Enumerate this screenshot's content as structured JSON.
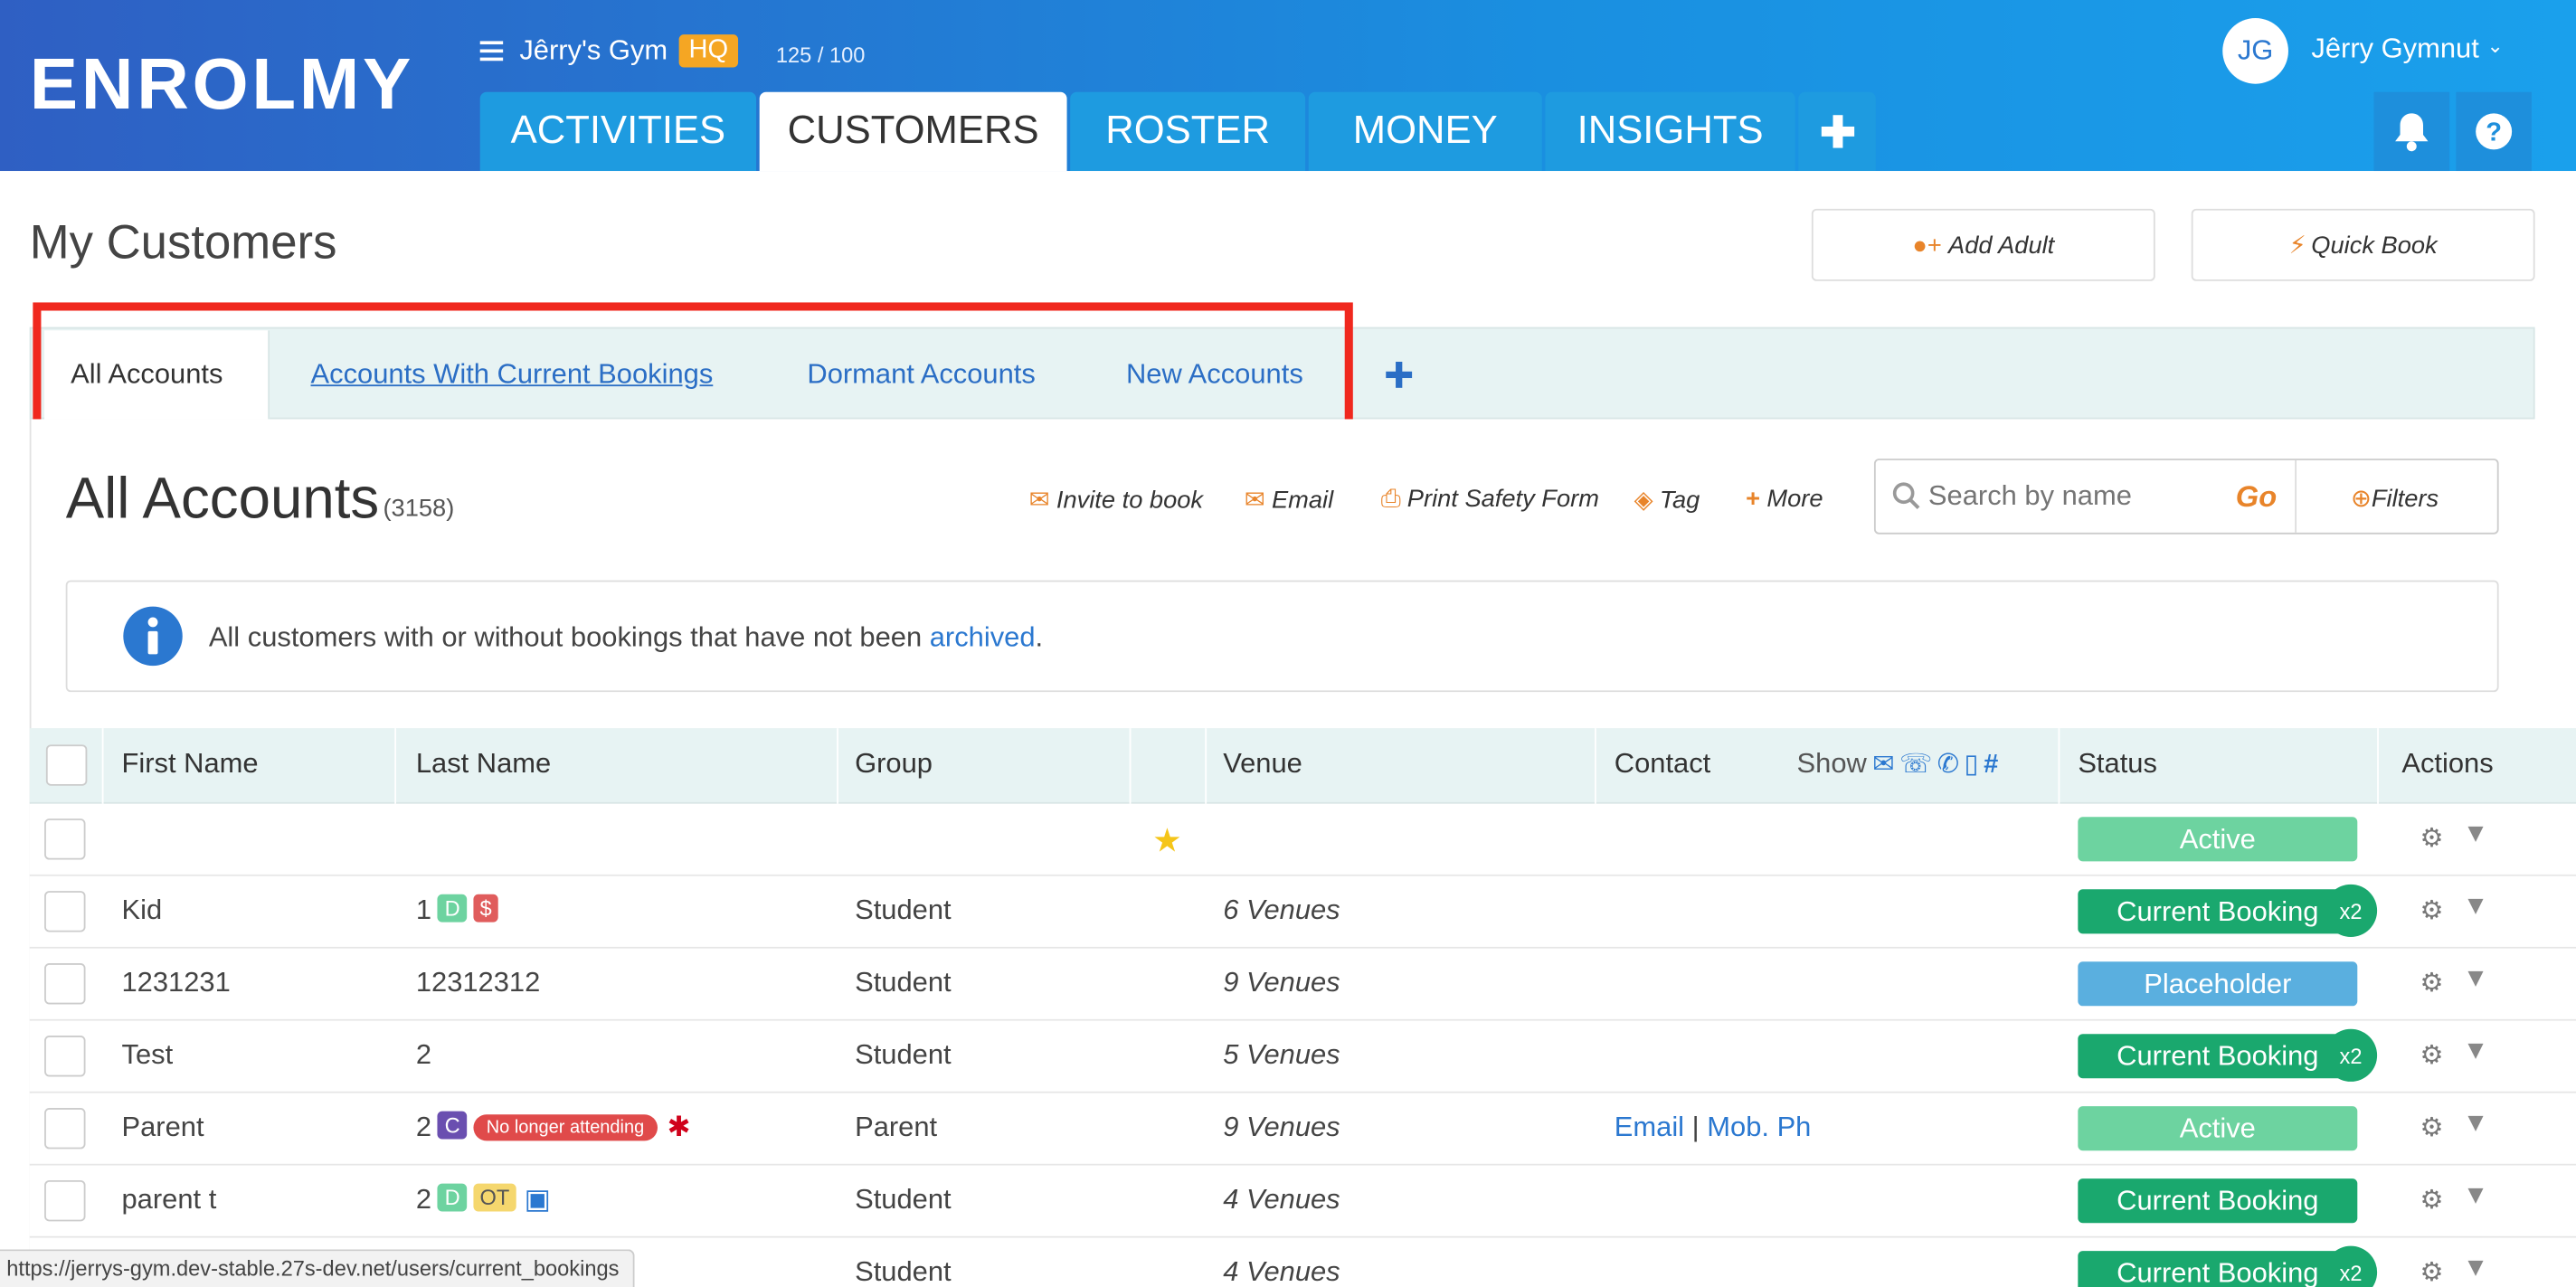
{
  "brand": {
    "logo_text": "ENROLMY"
  },
  "account": {
    "gym_name": "Jêrry's Gym",
    "hq_badge": "HQ",
    "usage": "125 / 100"
  },
  "nav": {
    "tabs": [
      {
        "label": "ACTIVITIES",
        "active": false
      },
      {
        "label": "CUSTOMERS",
        "active": true
      },
      {
        "label": "ROSTER",
        "active": false
      },
      {
        "label": "MONEY",
        "active": false
      },
      {
        "label": "INSIGHTS",
        "active": false
      }
    ],
    "add_icon": "plus-icon"
  },
  "user": {
    "initials": "JG",
    "name": "Jêrry Gymnut"
  },
  "page": {
    "title": "My Customers",
    "add_adult_label": "Add Adult",
    "quick_book_label": "Quick Book"
  },
  "subtabs": [
    {
      "label": "All Accounts",
      "active": true
    },
    {
      "label": "Accounts With Current Bookings",
      "active": false
    },
    {
      "label": "Dormant Accounts",
      "active": false
    },
    {
      "label": "New Accounts",
      "active": false
    }
  ],
  "list": {
    "heading": "All Accounts",
    "count": "(3158)",
    "actions": [
      "Invite to book",
      "Email",
      "Print Safety Form",
      "Tag",
      "More"
    ],
    "search_placeholder": "Search by name",
    "go_label": "Go",
    "filters_label": "Filters",
    "info_text": "All customers with or without bookings that have not been ",
    "info_link": "archived",
    "info_end": "."
  },
  "table": {
    "columns": {
      "first_name": "First Name",
      "last_name": "Last Name",
      "group": "Group",
      "venue": "Venue",
      "contact": "Contact",
      "show": "Show",
      "status": "Status",
      "actions": "Actions"
    },
    "rows": [
      {
        "first": "",
        "last": "",
        "group": "",
        "venue": "",
        "contact": "",
        "status": "Active",
        "x2": ""
      },
      {
        "first": "Kid",
        "last": "1",
        "group": "Student",
        "venue": "6 Venues",
        "contact": "",
        "status": "Current Booking",
        "x2": "x2"
      },
      {
        "first": "1231231",
        "last": "12312312",
        "group": "Student",
        "venue": "9 Venues",
        "contact": "",
        "status": "Placeholder",
        "x2": ""
      },
      {
        "first": "Test",
        "last": "2",
        "group": "Student",
        "venue": "5 Venues",
        "contact": "",
        "status": "Current Booking",
        "x2": "x2"
      },
      {
        "first": "Parent",
        "last": "2",
        "group": "Parent",
        "venue": "9 Venues",
        "contact_email": "Email",
        "contact_sep": "|",
        "contact_phone": "Mob. Ph",
        "status": "Active",
        "x2": ""
      },
      {
        "first": "parent t",
        "last": "2",
        "group": "Student",
        "venue": "4 Venues",
        "contact": "",
        "status": "Current Booking",
        "x2": ""
      },
      {
        "first": "",
        "last": "",
        "group": "Student",
        "venue": "4 Venues",
        "contact": "",
        "status": "Current Booking",
        "x2": "x2"
      }
    ],
    "tags": {
      "d": "D",
      "dollar": "$",
      "c": "C",
      "no_longer": "No longer attending",
      "ot": "OT"
    }
  },
  "browser_status": "https://jerrys-gym.dev-stable.27s-dev.net/users/current_bookings",
  "colors": {
    "active": "#6dd3a0",
    "current_booking": "#1aa86e",
    "placeholder": "#5aafdf",
    "accent": "#e8842a",
    "highlight": "#f0281e"
  }
}
